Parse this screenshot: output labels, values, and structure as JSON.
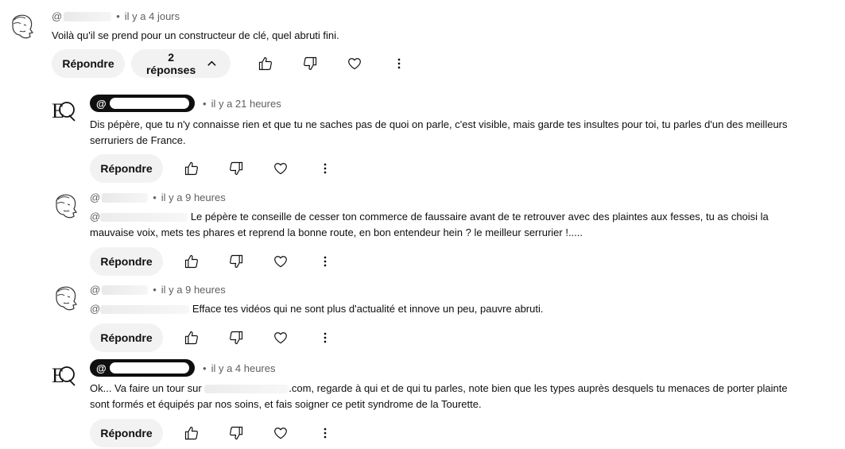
{
  "comments": [
    {
      "handle": "@",
      "time": "il y a 4 jours",
      "text": "Voilà qu'il se prend pour un constructeur de clé, quel abruti fini.",
      "reply_label": "Répondre",
      "replies_label": "2 réponses"
    },
    {
      "handle": "@",
      "time": "il y a 21 heures",
      "text": "Dis pépère, que tu n'y connaisse rien et que tu ne saches pas de quoi on parle, c'est visible, mais garde tes insultes pour toi, tu parles d'un des meilleurs serruriers de France.",
      "reply_label": "Répondre"
    },
    {
      "handle": "@",
      "time": "il y a 9 heures",
      "mention": "@",
      "text": "Le pépère te conseille de cesser ton commerce de faussaire avant de te retrouver avec des plaintes aux fesses, tu as choisi la mauvaise voix, mets tes phares et reprend la bonne route, en bon entendeur hein ? le meilleur serrurier !.....",
      "reply_label": "Répondre"
    },
    {
      "handle": "@",
      "time": "il y a 9 heures",
      "mention": "@",
      "text": "Efface tes vidéos qui ne sont plus d'actualité et innove un peu, pauvre abruti.",
      "reply_label": "Répondre"
    },
    {
      "handle": "@",
      "time": "il y a 4 heures",
      "text_prefix": "Ok... Va faire un tour sur",
      "text": ".com, regarde à qui et de qui tu parles, note bien que les types auprès desquels tu menaces de porter plainte sont formés et équipés par nos soins, et fais soigner ce petit syndrome de la Tourette.",
      "reply_label": "Répondre"
    }
  ],
  "icons": [
    "like-icon",
    "dislike-icon",
    "heart-icon",
    "more-vert-icon",
    "chevron-up-icon"
  ]
}
